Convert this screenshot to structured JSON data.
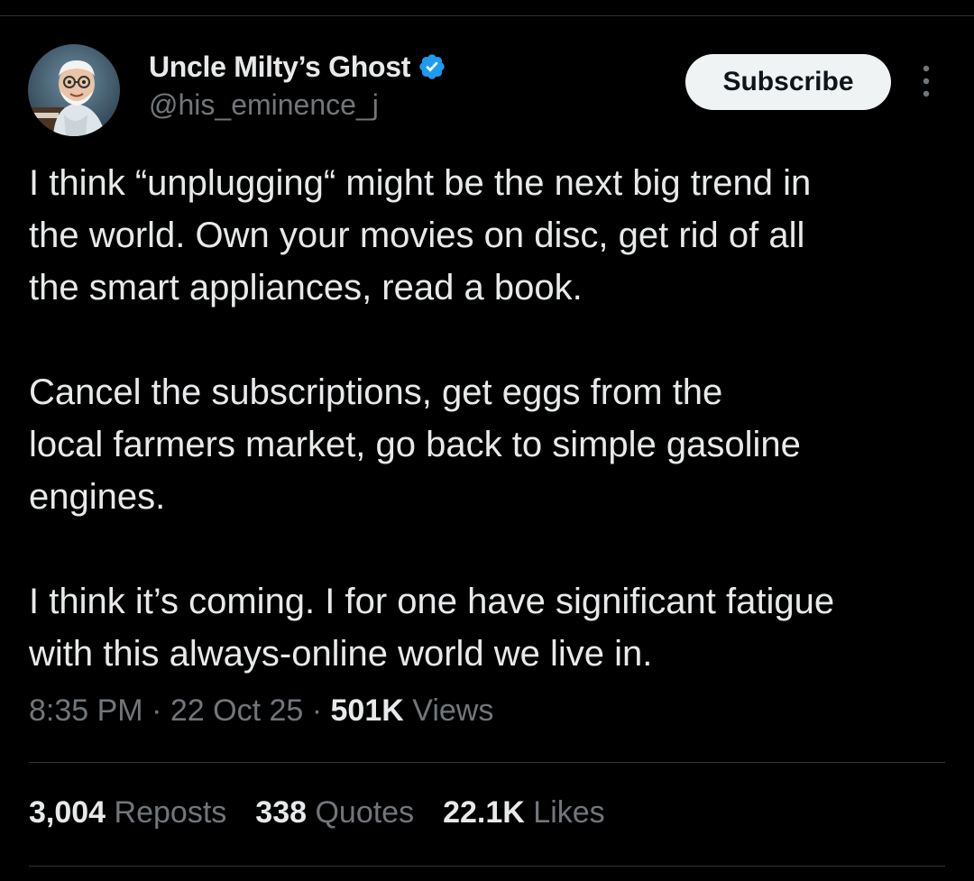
{
  "author": {
    "display_name": "Uncle Milty’s Ghost",
    "handle": "@his_eminence_j",
    "verified": true,
    "avatar_icon": "cartoon-old-man-avatar"
  },
  "header": {
    "subscribe_label": "Subscribe",
    "more_icon": "vertical-ellipsis-icon"
  },
  "tweet": {
    "lines": [
      "I think “unplugging“ might be the next big trend in",
      "the world. Own your movies on disc, get rid of all",
      "the smart appliances, read a book.",
      "Cancel the subscriptions, get eggs from the",
      "local farmers market, go back to simple gasoline",
      "engines.",
      "I think it’s coming. I for one have significant fatigue",
      "with this always-online world we live in."
    ]
  },
  "meta": {
    "time": "8:35 PM",
    "separator": "·",
    "date": "22 Oct 25",
    "views_count": "501K",
    "views_label": "Views"
  },
  "stats": {
    "reposts_count": "3,004",
    "reposts_label": "Reposts",
    "quotes_count": "338",
    "quotes_label": "Quotes",
    "likes_count": "22.1K",
    "likes_label": "Likes"
  },
  "colors": {
    "background": "#000000",
    "primary_text": "#e7e9ea",
    "secondary_text": "#71767b",
    "divider": "#2f3336",
    "verified_blue": "#1d9bf0",
    "button_bg": "#eff3f4"
  }
}
